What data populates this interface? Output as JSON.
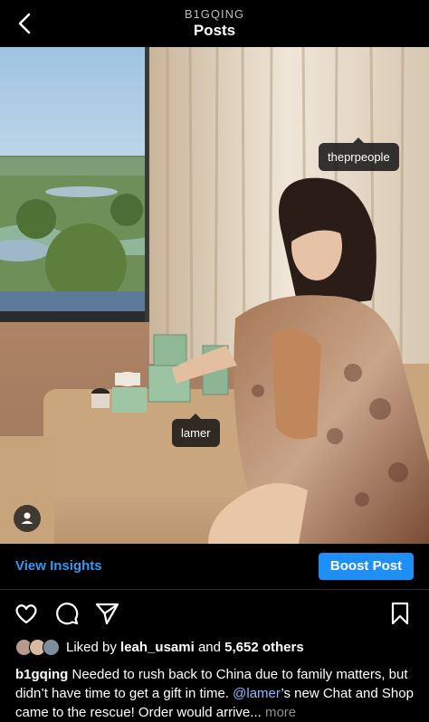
{
  "header": {
    "username": "B1GQING",
    "title": "Posts"
  },
  "photo": {
    "tags": [
      "theprpeople",
      "lamer"
    ]
  },
  "insights": {
    "view_label": "View Insights",
    "boost_label": "Boost Post"
  },
  "likes": {
    "prefix": "Liked by",
    "user": "leah_usami",
    "joiner": "and",
    "others": "5,652 others"
  },
  "caption": {
    "username": "b1gqing",
    "text_1": "Needed to rush back to China due to family matters, but didn’t have time to get a gift in time.",
    "mention": "@lamer",
    "text_2": "’s new Chat and Shop came to the rescue! Order would arrive...",
    "more": "more"
  },
  "colors": {
    "accent": "#3897f0",
    "boost_bg": "#1e90f5",
    "background": "#000000"
  },
  "icons": [
    "back-chevron-icon",
    "heart-icon",
    "comment-icon",
    "send-icon",
    "bookmark-icon",
    "user-tag-icon"
  ]
}
